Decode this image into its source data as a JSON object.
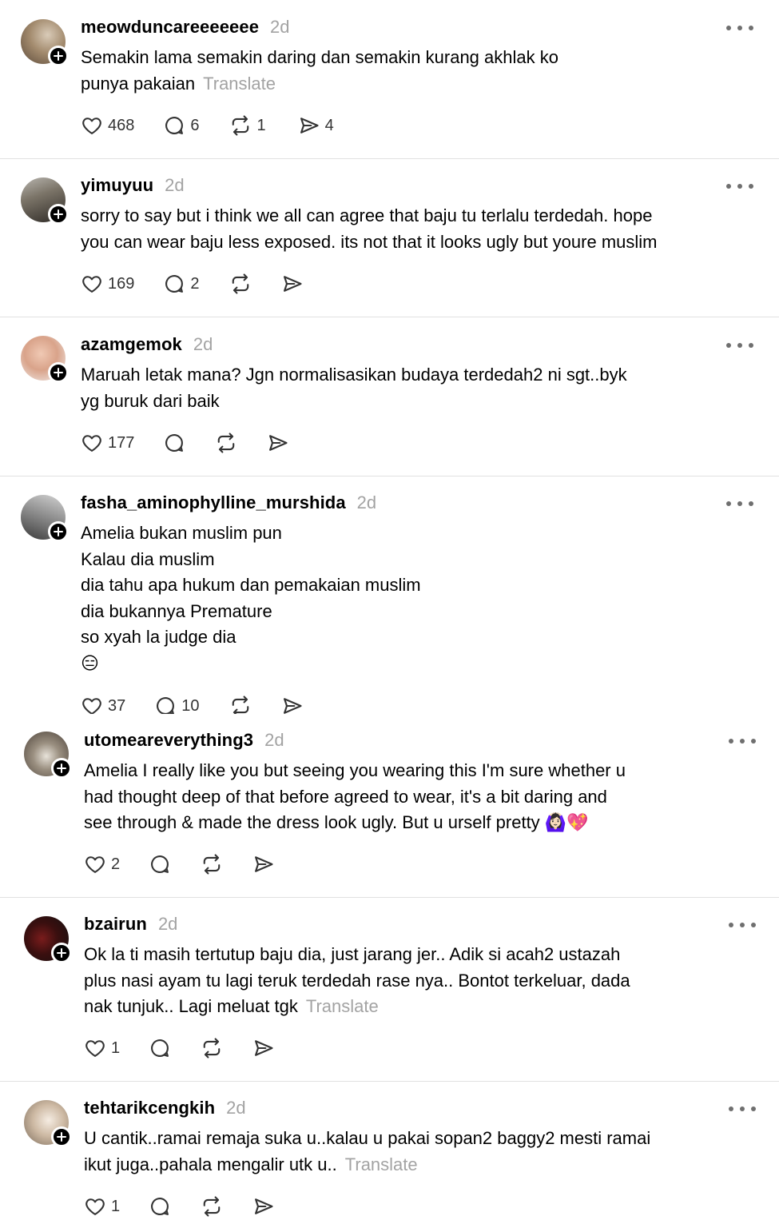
{
  "labels": {
    "translate": "Translate"
  },
  "posts": [
    {
      "username": "meowduncareeeeeee",
      "time": "2d",
      "lines": [
        "Semakin lama semakin daring dan semakin kurang akhlak ko",
        "punya pakaian"
      ],
      "translate": true,
      "likes": "468",
      "replies": "6",
      "reposts": "1",
      "shares": "4"
    },
    {
      "username": "yimuyuu",
      "time": "2d",
      "lines": [
        "sorry to say but i think we all can agree that baju tu terlalu terdedah. hope",
        "you can wear baju less exposed. its not that it looks ugly but youre muslim"
      ],
      "translate": false,
      "likes": "169",
      "replies": "2",
      "reposts": "",
      "shares": ""
    },
    {
      "username": "azamgemok",
      "time": "2d",
      "lines": [
        "Maruah letak mana? Jgn normalisasikan budaya terdedah2 ni sgt..byk",
        "yg buruk dari baik"
      ],
      "translate": false,
      "likes": "177",
      "replies": "",
      "reposts": "",
      "shares": ""
    },
    {
      "username": "fasha_aminophylline_murshida",
      "time": "2d",
      "lines": [
        "Amelia bukan muslim pun",
        "Kalau dia muslim",
        "dia tahu apa hukum dan pemakaian muslim",
        "dia bukannya Premature",
        "so xyah la judge dia",
        "😑"
      ],
      "translate": false,
      "likes": "37",
      "replies": "10",
      "reposts": "",
      "shares": ""
    },
    {
      "username": "utomeareverything3",
      "time": "2d",
      "lines": [
        "Amelia I really like you but seeing you wearing this I'm sure whether u",
        "had thought deep of that before agreed to wear, it's a bit daring and",
        "see through & made the dress look ugly. But u urself pretty 🙆🏻‍♀️💖"
      ],
      "translate": false,
      "likes": "2",
      "replies": "",
      "reposts": "",
      "shares": ""
    },
    {
      "username": "bzairun",
      "time": "2d",
      "lines": [
        "Ok la ti masih tertutup baju dia, just jarang jer.. Adik si acah2 ustazah",
        "plus nasi ayam tu lagi teruk terdedah rase nya.. Bontot terkeluar, dada",
        "nak tunjuk.. Lagi meluat tgk"
      ],
      "translate": true,
      "likes": "1",
      "replies": "",
      "reposts": "",
      "shares": ""
    },
    {
      "username": "tehtarikcengkih",
      "time": "2d",
      "lines": [
        "U cantik..ramai remaja suka u..kalau u pakai sopan2 baggy2 mesti ramai",
        "ikut juga..pahala mengalir utk u.."
      ],
      "translate": true,
      "likes": "1",
      "replies": "",
      "reposts": "",
      "shares": ""
    }
  ],
  "icons": {
    "like": "heart-icon",
    "reply": "comment-bubble-icon",
    "repost": "repost-icon",
    "share": "send-icon",
    "more": "more-horizontal-icon",
    "follow": "plus-icon"
  },
  "colors": {
    "muted": "#a3a3a3",
    "divider": "#e1e1e1",
    "icon": "#333333"
  }
}
